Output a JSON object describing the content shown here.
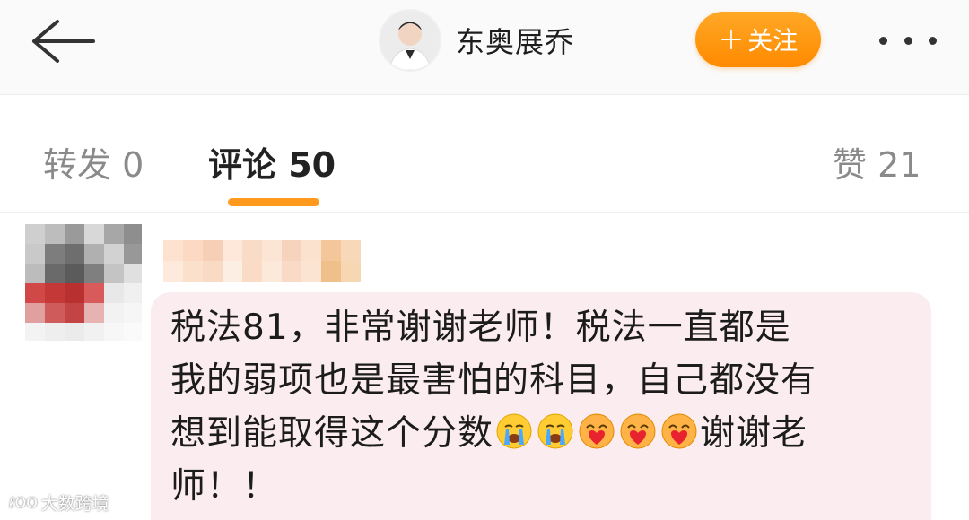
{
  "header": {
    "back_icon": "back-arrow-icon",
    "user_name": "东奥展乔",
    "follow_plus": "+",
    "follow_label": "关注",
    "more_icon": "more-dots-icon"
  },
  "tabs": {
    "repost": "转发 0",
    "comment": "评论 50",
    "like": "赞 21",
    "active_color": "#ff9a1f"
  },
  "comment": {
    "line1": "税法81，非常谢谢老师！税法一直都是",
    "line2": "我的弱项也是最害怕的科目，自己都没有",
    "line3_text": "想到能取得这个分数",
    "emojis": [
      "crying-emoji-icon",
      "crying-emoji-icon",
      "love-heart-emoji-icon",
      "love-heart-emoji-icon",
      "love-heart-emoji-icon"
    ],
    "line3_end": "谢谢老",
    "line4": "师！！"
  },
  "watermark": {
    "logo": "ℓOO",
    "text": "大数跨境"
  },
  "colors": {
    "follow_button": "#ff8a00",
    "bubble": "#fbecef"
  }
}
